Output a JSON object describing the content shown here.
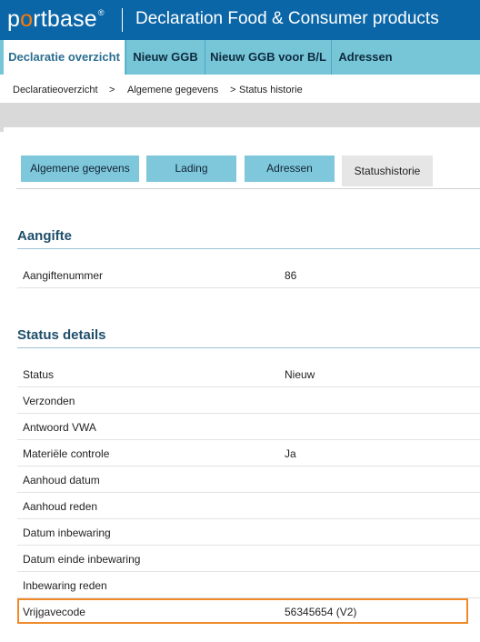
{
  "header": {
    "logo_text_p": "p",
    "logo_text_o": "o",
    "logo_text_rest": "rtbase",
    "logo_mark": "®",
    "app_title": "Declaration Food & Consumer products"
  },
  "mainnav": {
    "items": [
      {
        "label": "Declaratie overzicht",
        "active": true
      },
      {
        "label": "Nieuw GGB",
        "active": false
      },
      {
        "label": "Nieuw GGB voor B/L",
        "active": false
      },
      {
        "label": "Adressen",
        "active": false
      }
    ]
  },
  "breadcrumb": {
    "items": [
      "Declaratieoverzicht",
      "Algemene gegevens",
      "Status historie"
    ],
    "separator": ">"
  },
  "tabs": [
    {
      "label": "Algemene gegevens",
      "active": false
    },
    {
      "label": "Lading",
      "active": false
    },
    {
      "label": "Adressen",
      "active": false
    },
    {
      "label": "Statushistorie",
      "active": true
    }
  ],
  "aangifte": {
    "title": "Aangifte",
    "rows": [
      {
        "label": "Aangiftenummer",
        "value": "86"
      }
    ]
  },
  "status_details": {
    "title": "Status details",
    "rows": [
      {
        "label": "Status",
        "value": "Nieuw"
      },
      {
        "label": "Verzonden",
        "value": ""
      },
      {
        "label": "Antwoord VWA",
        "value": ""
      },
      {
        "label": "Materiële controle",
        "value": "Ja"
      },
      {
        "label": "Aanhoud datum",
        "value": ""
      },
      {
        "label": "Aanhoud reden",
        "value": ""
      },
      {
        "label": "Datum inbewaring",
        "value": ""
      },
      {
        "label": "Datum einde inbewaring",
        "value": ""
      },
      {
        "label": "Inbewaring reden",
        "value": ""
      },
      {
        "label": "Vrijgavecode",
        "value": "56345654 (V2)"
      }
    ]
  },
  "colors": {
    "header_bg": "#0b66a8",
    "nav_bg": "#77c6d8",
    "tab_bg": "#7fc8dc",
    "highlight": "#ef8a2a",
    "logo_accent": "#ff7a00"
  }
}
